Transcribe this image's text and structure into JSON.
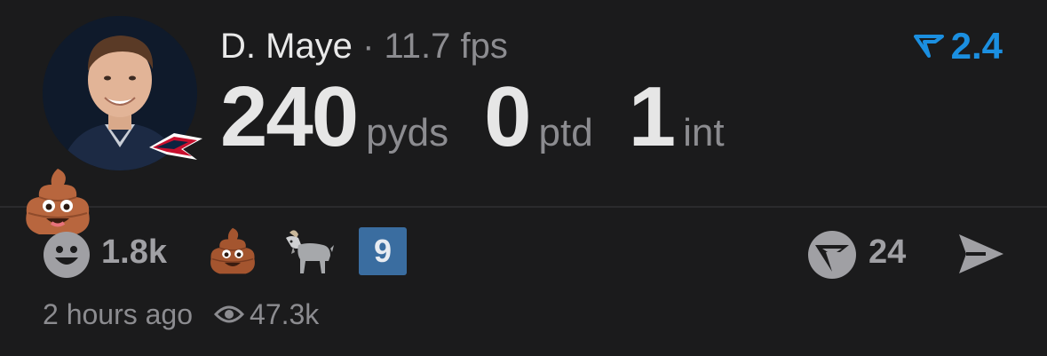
{
  "player": {
    "name": "D. Maye",
    "separator": "·",
    "fps": "11.7 fps",
    "team_logo": "patriots-logo"
  },
  "grade": {
    "icon": "v-grade-icon",
    "value": "2.4",
    "color": "#1b8fe0"
  },
  "stats": [
    {
      "value": "240",
      "unit": "pyds"
    },
    {
      "value": "0",
      "unit": "ptd"
    },
    {
      "value": "1",
      "unit": "int"
    }
  ],
  "reactions": {
    "top_reaction_icon": "pile-of-poo-emoji",
    "react_icon": "smile-face-icon",
    "react_count": "1.8k",
    "emojis": [
      "pile-of-poo-emoji",
      "goat-emoji",
      "keycap-9-emoji"
    ],
    "nine_badge": "9"
  },
  "comments": {
    "icon": "v-comment-icon",
    "count": "24"
  },
  "share": {
    "icon": "send-icon"
  },
  "meta": {
    "time": "2 hours ago",
    "views_icon": "eye-icon",
    "views": "47.3k"
  }
}
